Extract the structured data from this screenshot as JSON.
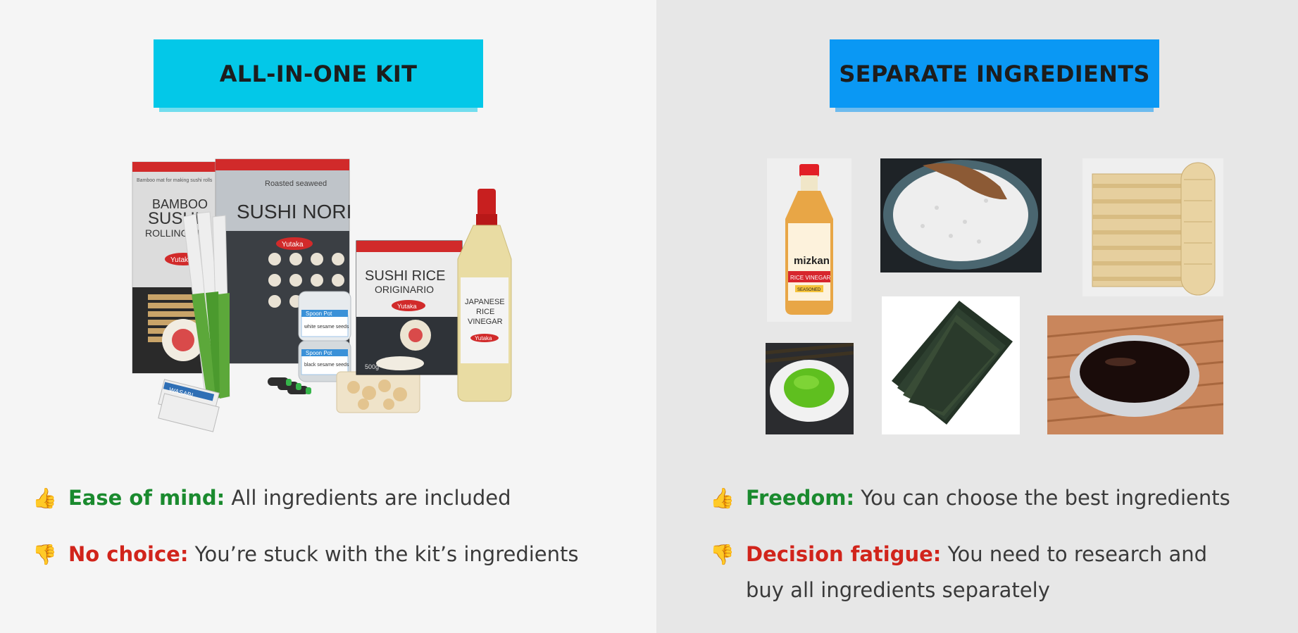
{
  "left": {
    "banner": "ALL-IN-ONE KIT",
    "kit": {
      "mat_brand_text": "Bamboo mat for making sushi rolls",
      "mat_title": [
        "BAMBOO",
        "SUSHI",
        "ROLLING MAT"
      ],
      "nori_top": "Roasted seaweed",
      "nori_title": "SUSHI NORI",
      "brand": "Yutaka",
      "rice_title": [
        "SUSHI RICE",
        "ORIGINARIO"
      ],
      "rice_weight": "500g",
      "vinegar_title": [
        "JAPANESE",
        "RICE",
        "VINEGAR"
      ],
      "sesame_top": "Spoon Pot",
      "sesame_white": "white sesame seeds",
      "sesame_black": "black sesame seeds",
      "wasabi_pack": "WASABI"
    },
    "points": [
      {
        "icon": "👍",
        "label": "Ease of mind:",
        "text": " All ingredients are included",
        "tone": "good"
      },
      {
        "icon": "👎",
        "label": "No choice:",
        "text": " You’re stuck with the kit’s ingredients",
        "tone": "bad"
      }
    ]
  },
  "right": {
    "banner": "SEPARATE INGREDIENTS",
    "vinegar": {
      "brand": "mizkan",
      "product": "RICE VINEGAR",
      "variant": "SEASONED"
    },
    "points": [
      {
        "icon": "👍",
        "label": "Freedom:",
        "text": " You can choose the best ingredients",
        "tone": "good"
      },
      {
        "icon": "👎",
        "label": "Decision fatigue:",
        "text": " You need to research and buy all ingredients separately",
        "tone": "bad"
      }
    ]
  },
  "colors": {
    "left_banner": "#03c8e8",
    "right_banner": "#0a98f4",
    "good": "#1a8a2e",
    "bad": "#d1241b"
  }
}
